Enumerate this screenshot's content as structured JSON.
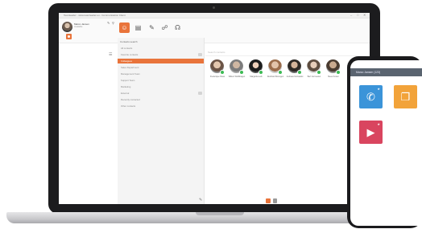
{
  "window": {
    "title": "Teamleader - www.teamleader.eu - Communication Client",
    "controls": [
      "–",
      "□",
      "✕"
    ]
  },
  "profile": {
    "name": "Marco Jansen",
    "status": "Available",
    "pin_glyph": "✎",
    "bell_glyph": "⚲"
  },
  "nav_tabs": [
    {
      "name": "contacts",
      "glyph": "☺",
      "active": true
    },
    {
      "name": "directory",
      "glyph": "▤",
      "active": false
    },
    {
      "name": "edit",
      "glyph": "✎",
      "active": false
    },
    {
      "name": "voicemail",
      "glyph": "☍",
      "active": false
    },
    {
      "name": "chat",
      "glyph": "☊",
      "active": false
    }
  ],
  "sidebar": {
    "search_label": "Contacts search",
    "items": [
      {
        "label": "All contacts",
        "active": false,
        "chevron": false
      },
      {
        "label": "Favorite contacts",
        "active": false,
        "chevron": true
      },
      {
        "label": "Colleagues",
        "active": true,
        "chevron": false
      },
      {
        "label": "Sales Department",
        "active": false,
        "chevron": false
      },
      {
        "label": "Management Team",
        "active": false,
        "chevron": false
      },
      {
        "label": "Support Team",
        "active": false,
        "chevron": false
      },
      {
        "label": "Marketing",
        "active": false,
        "chevron": false
      },
      {
        "label": "External",
        "active": false,
        "chevron": true
      },
      {
        "label": "Recently contacted",
        "active": false,
        "chevron": false
      },
      {
        "label": "Other contacts",
        "active": false,
        "chevron": false
      }
    ]
  },
  "content": {
    "search_placeholder": "Search contacts",
    "gear_glyph": "⚙",
    "list_glyph": "☰"
  },
  "contacts": [
    {
      "name": "Frederique Pauw",
      "status": "online"
    },
    {
      "name": "Willem Wolfshagen",
      "status": "online"
    },
    {
      "name": "Margarita Leib",
      "status": "online"
    },
    {
      "name": "Reinhard Monogen",
      "status": "online"
    },
    {
      "name": "Andreas Kurzawski",
      "status": "online"
    },
    {
      "name": "Bert Vermeulen",
      "status": "online"
    },
    {
      "name": "Mees Koster",
      "status": "online"
    }
  ],
  "footer": {
    "edit_glyph": "✎"
  },
  "phone": {
    "header_title": "Marco Jansen",
    "header_extra": "(123)",
    "tiles": [
      {
        "name": "call",
        "glyph": "✆",
        "color": "#3b94d9"
      },
      {
        "name": "conference",
        "glyph": "❐",
        "color": "#f2a33a"
      },
      {
        "name": "video",
        "glyph": "▶",
        "color": "#d9455f"
      }
    ]
  },
  "colors": {
    "accent": "#e9743b",
    "online": "#3cba54"
  }
}
